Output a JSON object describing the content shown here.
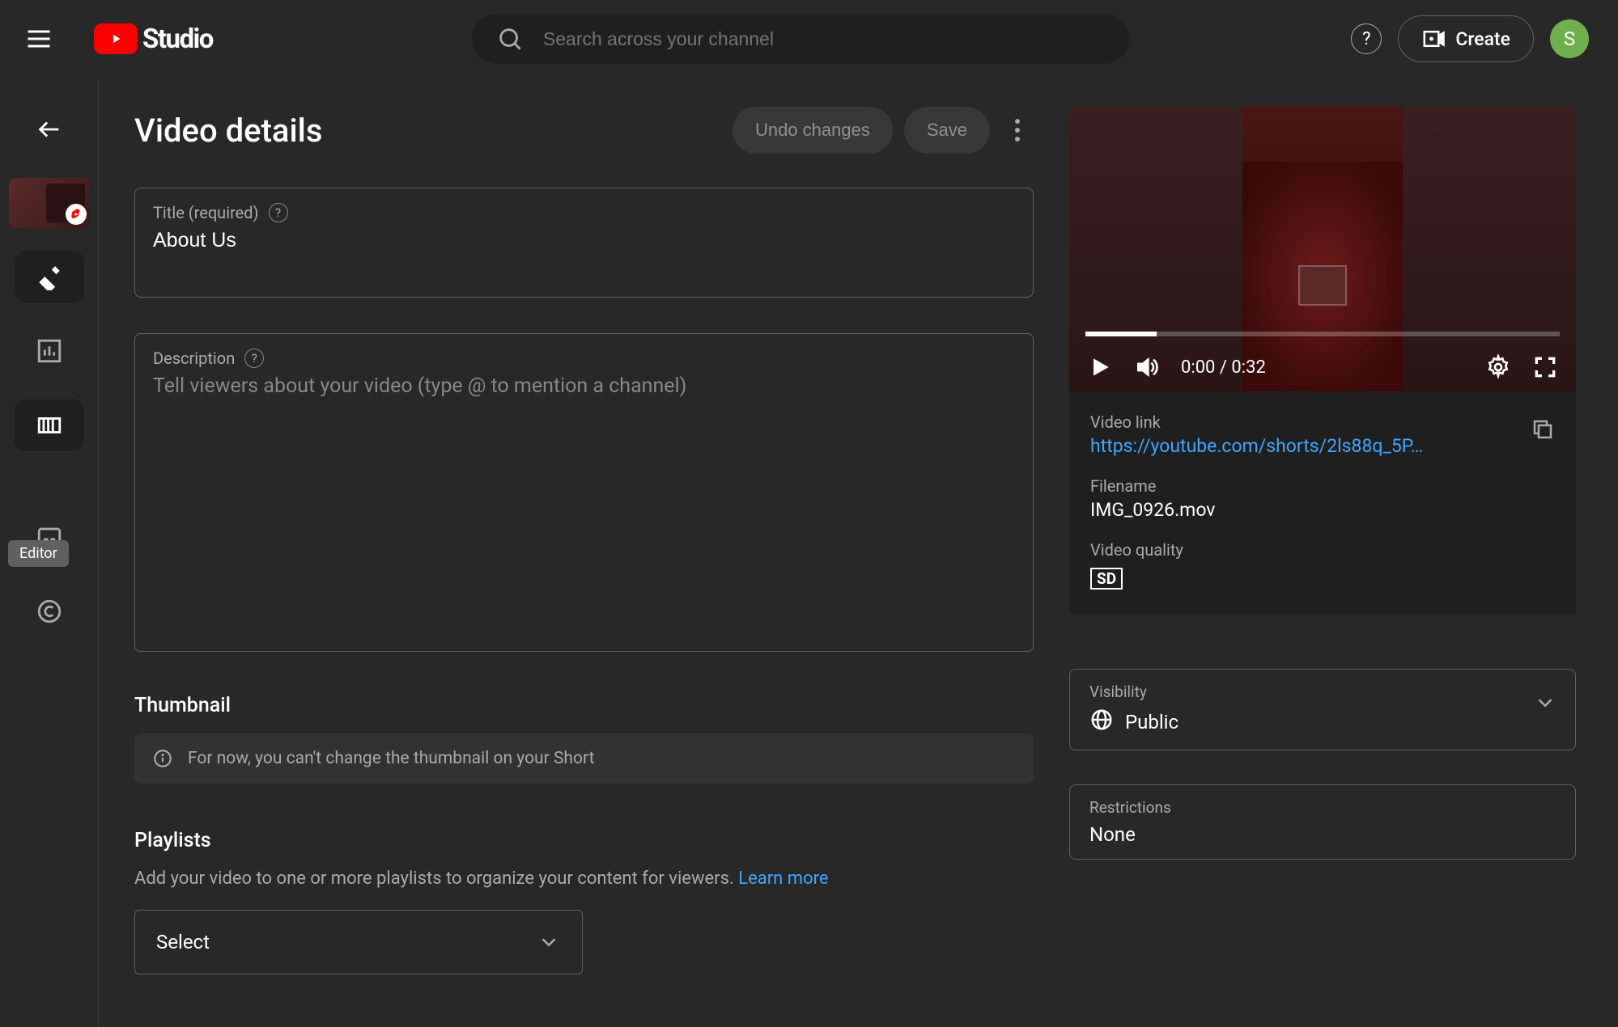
{
  "header": {
    "logo_text": "Studio",
    "search_placeholder": "Search across your channel",
    "create_label": "Create",
    "avatar_letter": "S"
  },
  "sidebar": {
    "tooltip": "Editor"
  },
  "page": {
    "title": "Video details",
    "undo_label": "Undo changes",
    "save_label": "Save"
  },
  "form": {
    "title": {
      "label": "Title (required)",
      "value": "About Us"
    },
    "description": {
      "label": "Description",
      "placeholder": "Tell viewers about your video (type @ to mention a channel)",
      "value": ""
    },
    "thumbnail": {
      "heading": "Thumbnail",
      "notice": "For now, you can't change the thumbnail on your Short"
    },
    "playlists": {
      "heading": "Playlists",
      "body": "Add your video to one or more playlists to organize your content for viewers. ",
      "learn_more": "Learn more",
      "select_label": "Select"
    }
  },
  "player": {
    "current_time": "0:00",
    "duration": "0:32",
    "time_display": "0:00 / 0:32",
    "progress_pct": 15
  },
  "meta": {
    "video_link_label": "Video link",
    "video_link": "https://youtube.com/shorts/2ls88q_5P…",
    "filename_label": "Filename",
    "filename": "IMG_0926.mov",
    "quality_label": "Video quality",
    "quality_badge": "SD"
  },
  "side": {
    "visibility": {
      "label": "Visibility",
      "value": "Public"
    },
    "restrictions": {
      "label": "Restrictions",
      "value": "None"
    }
  }
}
